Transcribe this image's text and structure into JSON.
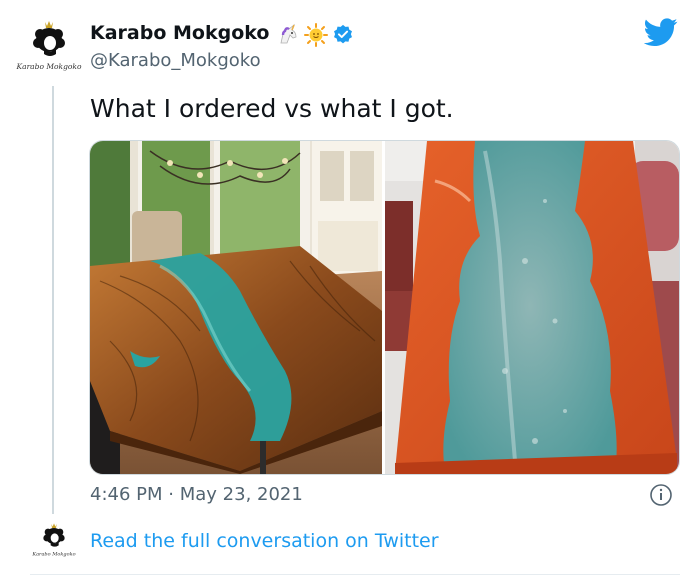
{
  "author": {
    "display_name": "Karabo Mokgoko",
    "handle": "@Karabo_Mokgoko",
    "logo_text": "Karabo Mokgoko",
    "badges": [
      "unicorn-icon",
      "sun-icon",
      "verified-icon"
    ]
  },
  "tweet": {
    "text": "What I ordered vs what I got.",
    "time": "4:46 PM",
    "separator": "·",
    "date": "May 23, 2021"
  },
  "media": [
    {
      "name": "photo-ordered",
      "depicts": "wooden river table with teal resin"
    },
    {
      "name": "photo-received",
      "depicts": "orange table with teal resin"
    }
  ],
  "footer": {
    "read_more": "Read the full conversation on Twitter"
  },
  "colors": {
    "link": "#1d9bf0",
    "secondary_text": "#536471",
    "twitter_blue": "#1d9bf0",
    "verified": "#1d9bf0"
  }
}
